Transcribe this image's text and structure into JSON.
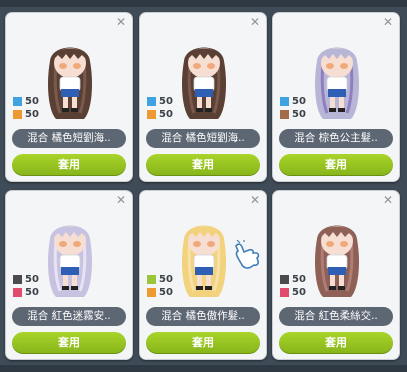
{
  "cards": [
    {
      "name": "混合  橘色短劉海..",
      "button": "套用",
      "colors": [
        {
          "hex": "#3ea3e0",
          "pct": "50"
        },
        {
          "hex": "#ee9a33",
          "pct": "50"
        }
      ],
      "hair": "#5a3f35",
      "hair2": "#7a5a4d",
      "icon": "character-icon"
    },
    {
      "name": "混合  橘色短劉海..",
      "button": "套用",
      "colors": [
        {
          "hex": "#3ea3e0",
          "pct": "50"
        },
        {
          "hex": "#ee9a33",
          "pct": "50"
        }
      ],
      "hair": "#5a3f35",
      "hair2": "#7a5a4d",
      "icon": "character-icon"
    },
    {
      "name": "混合  棕色公主髮..",
      "button": "套用",
      "colors": [
        {
          "hex": "#3ea3e0",
          "pct": "50"
        },
        {
          "hex": "#a26c4a",
          "pct": "50"
        }
      ],
      "hair": "#b8b6d6",
      "hair2": "#8f7fbf",
      "icon": "character-icon"
    },
    {
      "name": "混合  紅色迷霧安..",
      "button": "套用",
      "colors": [
        {
          "hex": "#4a4a4f",
          "pct": "50"
        },
        {
          "hex": "#e14b6c",
          "pct": "50"
        }
      ],
      "hair": "#c6c2e0",
      "hair2": "#e7e3f5",
      "icon": "character-icon"
    },
    {
      "name": "混合  橘色傲作髮..",
      "button": "套用",
      "colors": [
        {
          "hex": "#9bc63a",
          "pct": "50"
        },
        {
          "hex": "#ee9a33",
          "pct": "50"
        }
      ],
      "hair": "#f2d27d",
      "hair2": "#f6e2a8",
      "icon": "character-icon"
    },
    {
      "name": "混合  紅色柔絲交..",
      "button": "套用",
      "colors": [
        {
          "hex": "#4a4a4f",
          "pct": "50"
        },
        {
          "hex": "#e14b6c",
          "pct": "50"
        }
      ],
      "hair": "#8e6058",
      "hair2": "#b07d73",
      "icon": "character-icon"
    }
  ],
  "cursor_icon": "pointing-hand-icon"
}
